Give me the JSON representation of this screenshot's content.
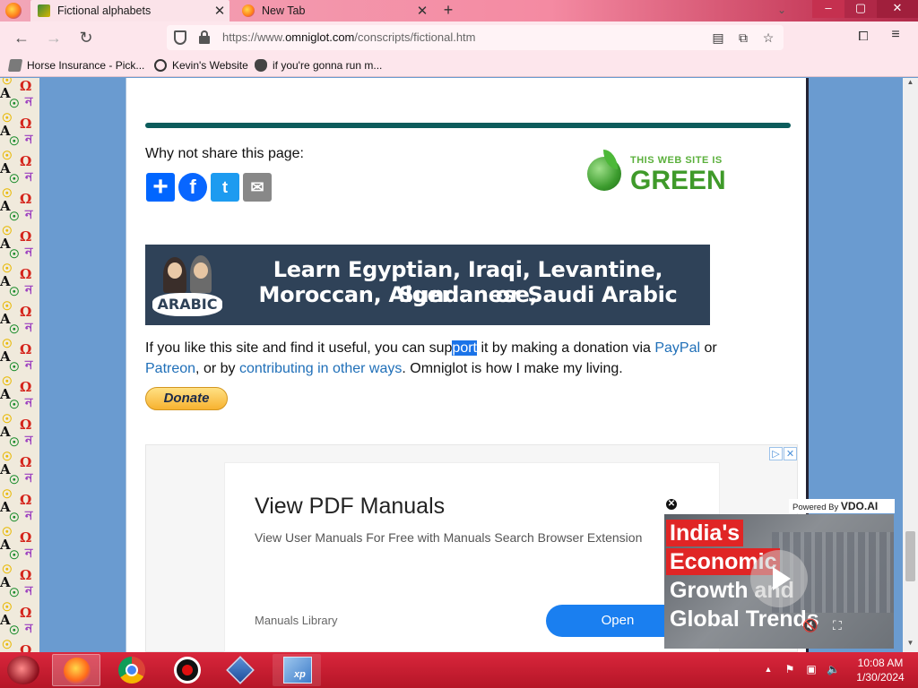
{
  "browser": {
    "tabs": [
      {
        "label": "Fictional alphabets",
        "active": true
      },
      {
        "label": "New Tab",
        "active": false
      }
    ],
    "new_tab": "+",
    "url_prefix": "https://www.",
    "url_domain": "omniglot.com",
    "url_path": "/conscripts/fictional.htm",
    "bookmarks": [
      {
        "label": "Horse Insurance - Pick..."
      },
      {
        "label": "Kevin's Website"
      },
      {
        "label": "if you're gonna run m..."
      }
    ]
  },
  "page": {
    "share_prompt": "Why not share this page:",
    "share_buttons": [
      "+",
      "f",
      "t",
      "✉"
    ],
    "green_badge": {
      "small": "THIS WEB SITE IS",
      "big": "GREEN"
    },
    "arabic_banner": {
      "logo": "ARABIC",
      "line1": "Learn Egyptian, Iraqi, Levantine, Sundanese,",
      "line2": "Moroccan, Algerian or Saudi Arabic"
    },
    "support": {
      "t1": "If you like this site and find it useful, you can sup",
      "t_sel": "port",
      "t2": " it by making a donation via ",
      "paypal": "PayPal",
      "t3": " or ",
      "patreon": "Patreon",
      "t4": ", or by ",
      "contrib": "contributing in other ways",
      "t5": ". Omniglot is how I make my living."
    },
    "donate_label": "Donate",
    "ad": {
      "title": "View PDF Manuals",
      "description": "View User Manuals For Free with Manuals Search Browser Extension",
      "source": "Manuals Library",
      "cta": "Open"
    },
    "video": {
      "powered_by": "Powered By",
      "brand": "VDO.AI",
      "line1": "India's",
      "line2": "Economic",
      "line3": "Growth and",
      "line4": "Global Trends"
    }
  },
  "taskbar": {
    "time": "10:08 AM",
    "date": "1/30/2024"
  },
  "colors": {
    "divider": "#0c5c5c",
    "link": "#1f6fb8",
    "taskbar": "#c41e30"
  }
}
